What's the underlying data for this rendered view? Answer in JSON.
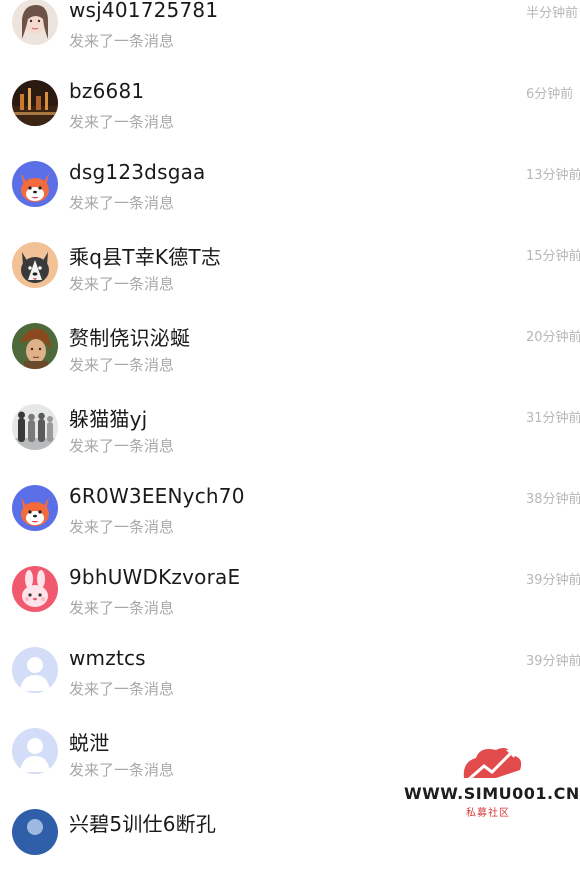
{
  "messages": [
    {
      "name": "wsj401725781",
      "preview": "发来了一条消息",
      "time": "半分钟前",
      "avatar": "avatar-girl-photo-icon"
    },
    {
      "name": "bz6681",
      "preview": "发来了一条消息",
      "time": "6分钟前",
      "avatar": "avatar-city-night-icon"
    },
    {
      "name": "dsg123dsgaa",
      "preview": "发来了一条消息",
      "time": "13分钟前",
      "avatar": "avatar-fox-icon"
    },
    {
      "name": "乘q县T幸K德T志",
      "preview": "发来了一条消息",
      "time": "15分钟前",
      "avatar": "avatar-husky-icon"
    },
    {
      "name": "赘制侥识泌蜒",
      "preview": "发来了一条消息",
      "time": "20分钟前",
      "avatar": "avatar-warrior-icon"
    },
    {
      "name": "躲猫猫yj",
      "preview": "发来了一条消息",
      "time": "31分钟前",
      "avatar": "avatar-people-photo-icon"
    },
    {
      "name": "6R0W3EENych70",
      "preview": "发来了一条消息",
      "time": "38分钟前",
      "avatar": "avatar-fox-icon"
    },
    {
      "name": "9bhUWDKzvoraE",
      "preview": "发来了一条消息",
      "time": "39分钟前",
      "avatar": "avatar-bunny-icon"
    },
    {
      "name": "wmztcs",
      "preview": "发来了一条消息",
      "time": "39分钟前",
      "avatar": "avatar-default-icon"
    },
    {
      "name": "蜕泄",
      "preview": "发来了一条消息",
      "time": "",
      "avatar": "avatar-default-icon"
    },
    {
      "name": "兴碧5训仕6断孔",
      "preview": "",
      "time": "",
      "avatar": "avatar-default-icon"
    }
  ],
  "watermark": {
    "site": "WWW.SIMU001.CN",
    "label": "私募社区"
  },
  "colors": {
    "name": "#1a1a1a",
    "preview": "#a8a8a8",
    "time": "#b7b7b7",
    "default_avatar": "#c9d6f5"
  }
}
